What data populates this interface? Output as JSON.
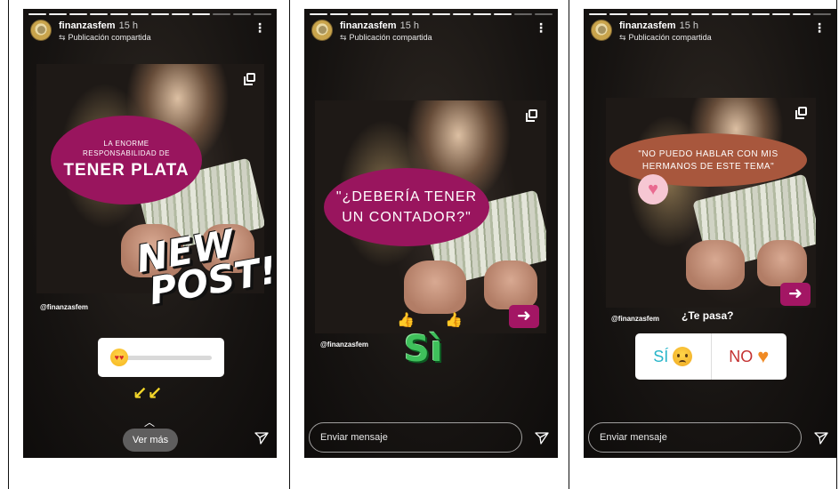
{
  "stories": [
    {
      "username": "finanzasfem",
      "time": "15 h",
      "shared_label": "Publicación compartida",
      "more_icon": "more-vertical-icon",
      "post": {
        "line1": "LA ENORME",
        "line2": "RESPONSABILIDAD DE",
        "headline": "TENER PLATA",
        "handle": "@finanzasfem"
      },
      "sticker_line1": "NEW",
      "sticker_line2": "POST!",
      "slider_value": 0,
      "ver_mas": "Ver más"
    },
    {
      "username": "finanzasfem",
      "time": "15 h",
      "shared_label": "Publicación compartida",
      "more_icon": "more-vertical-icon",
      "post": {
        "line1": "\"¿DEBERÍA TENER",
        "line2": "UN CONTADOR?\"",
        "handle": "@finanzasfem"
      },
      "si_sticker": "Sì",
      "message_placeholder": "Enviar mensaje"
    },
    {
      "username": "finanzasfem",
      "time": "15 h",
      "shared_label": "Publicación compartida",
      "more_icon": "more-vertical-icon",
      "post": {
        "line1": "\"NO PUEDO HABLAR CON MIS",
        "line2": "HERMANOS DE ESTE TEMA\"",
        "handle": "@finanzasfem"
      },
      "question": "¿Te pasa?",
      "poll_yes": "SÍ",
      "poll_no": "NO",
      "message_placeholder": "Enviar mensaje"
    }
  ],
  "colors": {
    "magenta": "#99155e",
    "brown": "#a8573d",
    "poll_yes": "#27b5c9",
    "poll_no": "#c43232"
  }
}
